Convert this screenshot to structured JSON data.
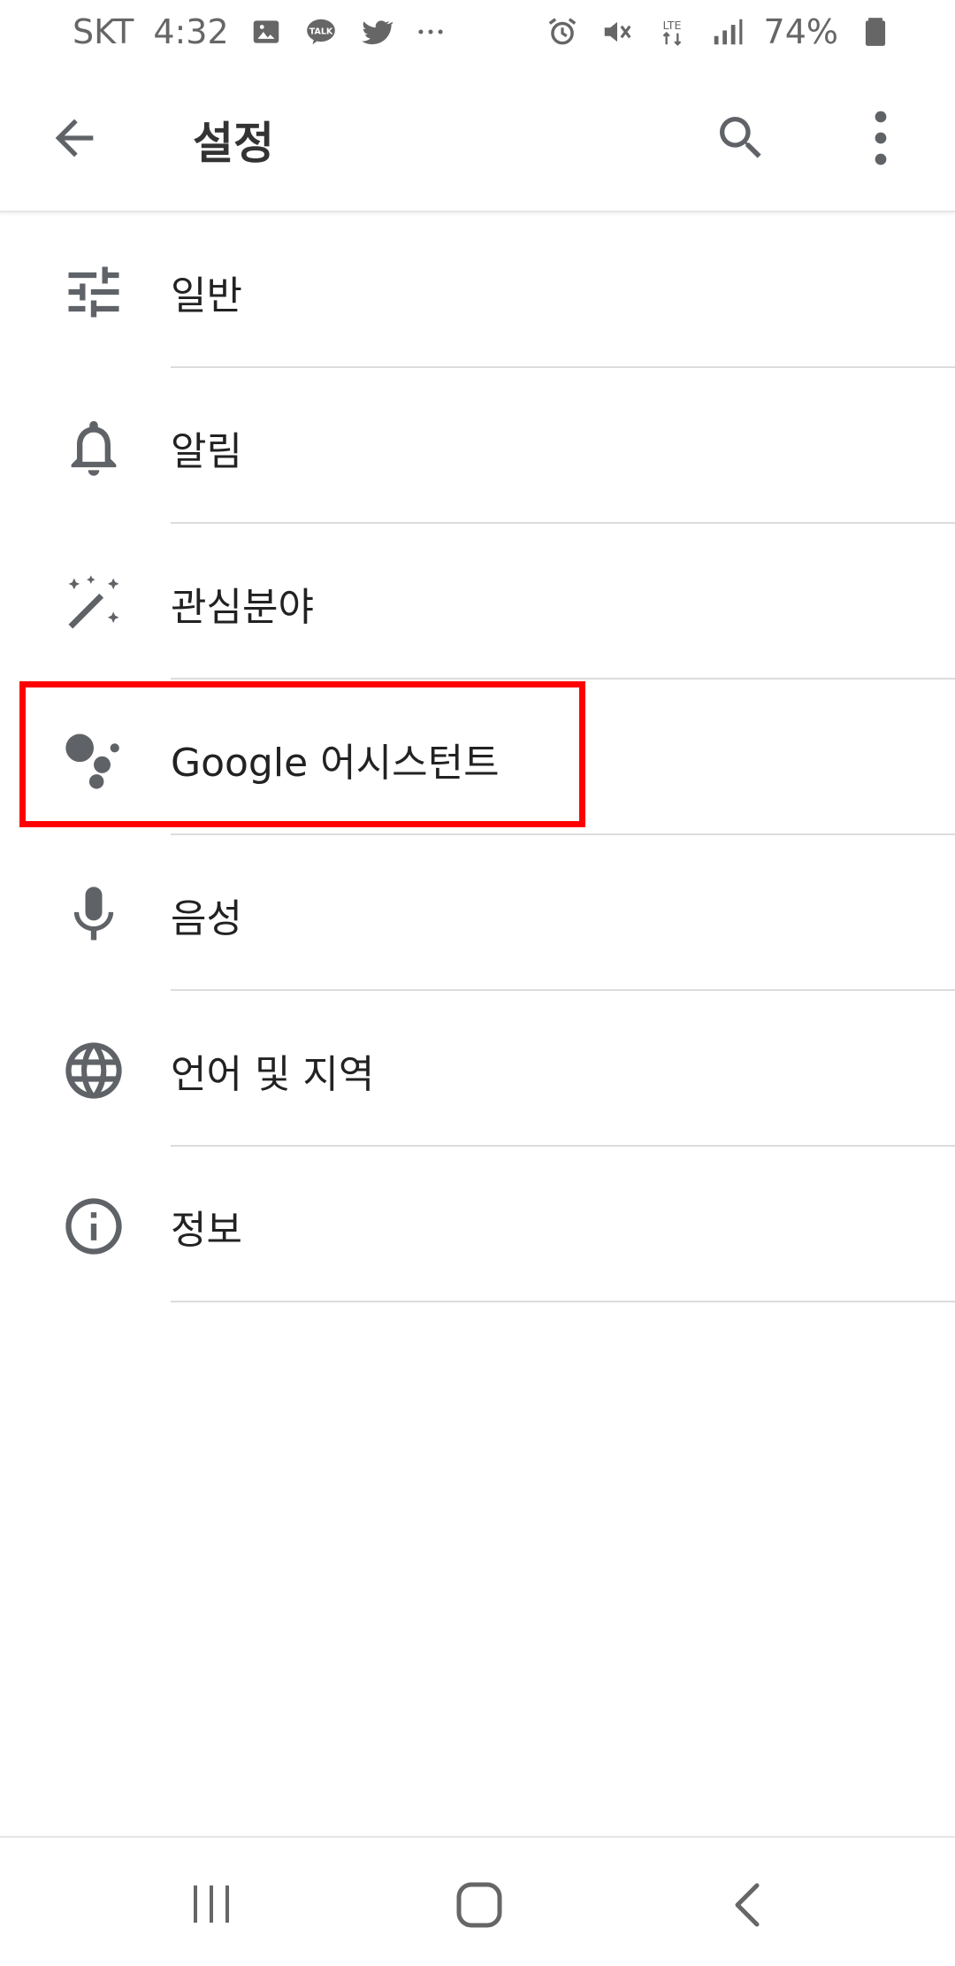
{
  "status_bar": {
    "carrier": "SKT",
    "time": "4:32",
    "left_icons": [
      "image-icon",
      "kakaotalk-icon",
      "twitter-icon",
      "more-notifications-icon"
    ],
    "right_icons": [
      "alarm-icon",
      "mute-icon",
      "lte-icon",
      "signal-icon",
      "battery-icon"
    ],
    "network": "LTE",
    "battery": "74%"
  },
  "app_bar": {
    "title": "설정",
    "back_icon": "arrow-back-icon",
    "search_icon": "search-icon",
    "more_icon": "more-vert-icon"
  },
  "settings": {
    "items": [
      {
        "label": "일반",
        "icon": "tune-icon"
      },
      {
        "label": "알림",
        "icon": "bell-icon"
      },
      {
        "label": "관심분야",
        "icon": "magic-wand-icon"
      },
      {
        "label": "Google 어시스턴트",
        "icon": "google-assistant-icon",
        "highlighted": true
      },
      {
        "label": "음성",
        "icon": "microphone-icon"
      },
      {
        "label": "언어 및 지역",
        "icon": "globe-icon"
      },
      {
        "label": "정보",
        "icon": "info-icon"
      }
    ]
  },
  "nav_bar": {
    "recent_icon": "recent-apps-icon",
    "home_icon": "home-icon",
    "back_icon": "back-icon"
  },
  "colors": {
    "icon": "#5f6368",
    "highlight": "#ff0000",
    "divider": "#dcdcdc"
  }
}
